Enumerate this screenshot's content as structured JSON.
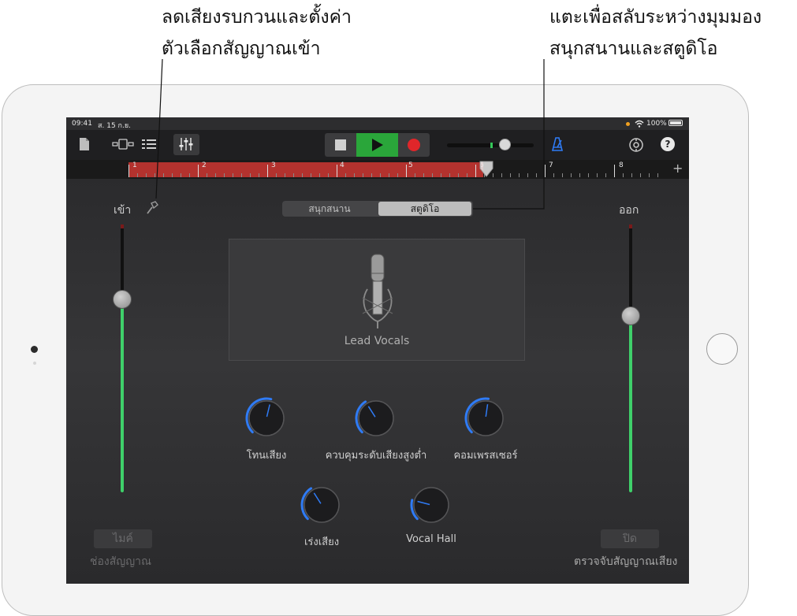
{
  "callouts": {
    "left_line1": "ลดเสียงรบกวนและตั้งค่า",
    "left_line2": "ตัวเลือกสัญญาณเข้า",
    "right_line1": "แตะเพื่อสลับระหว่างมุมมอง",
    "right_line2": "สนุกสนานและสตูดิโอ"
  },
  "status_bar": {
    "time": "09:41",
    "date": "ส. 15 ก.ย.",
    "battery": "100%"
  },
  "toolbar": {
    "icons": [
      "document-icon",
      "tracks-view-icon",
      "track-list-icon",
      "mixer-icon",
      "stop-icon",
      "play-icon",
      "record-icon",
      "volume-slider",
      "metronome-icon",
      "settings-icon",
      "help-icon"
    ],
    "help_label": "?",
    "accent_color": "#2f7bf5",
    "play_color": "#2aa63a",
    "record_color": "#e0262a"
  },
  "ruler": {
    "bars": [
      "1",
      "2",
      "3",
      "4",
      "5",
      "6",
      "7",
      "8"
    ],
    "add_label": "+",
    "region_color": "#b3322e",
    "playhead_bar": 6
  },
  "input": {
    "label": "เข้า",
    "level": 0.72,
    "mic_button": "ไมค์",
    "channel_label": "ช่องสัญญาณ"
  },
  "output": {
    "label": "ออก",
    "level": 0.66,
    "off_button": "ปิด",
    "detect_label": "ตรวจจับสัญญาณเสียง"
  },
  "segment": {
    "fun": "สนุกสนาน",
    "studio": "สตูดิโอ",
    "selected": "สตูดิโอ"
  },
  "preset": {
    "name": "Lead Vocals"
  },
  "knobs": [
    {
      "label": "โทนเสียง",
      "value": 0.55
    },
    {
      "label": "ควบคุมระดับเสียงสูงต่ำ",
      "value": 0.38
    },
    {
      "label": "คอมเพรสเซอร์",
      "value": 0.53
    },
    {
      "label": "เร่งเสียง",
      "value": 0.38
    },
    {
      "label": "Vocal Hall",
      "value": 0.22
    }
  ]
}
